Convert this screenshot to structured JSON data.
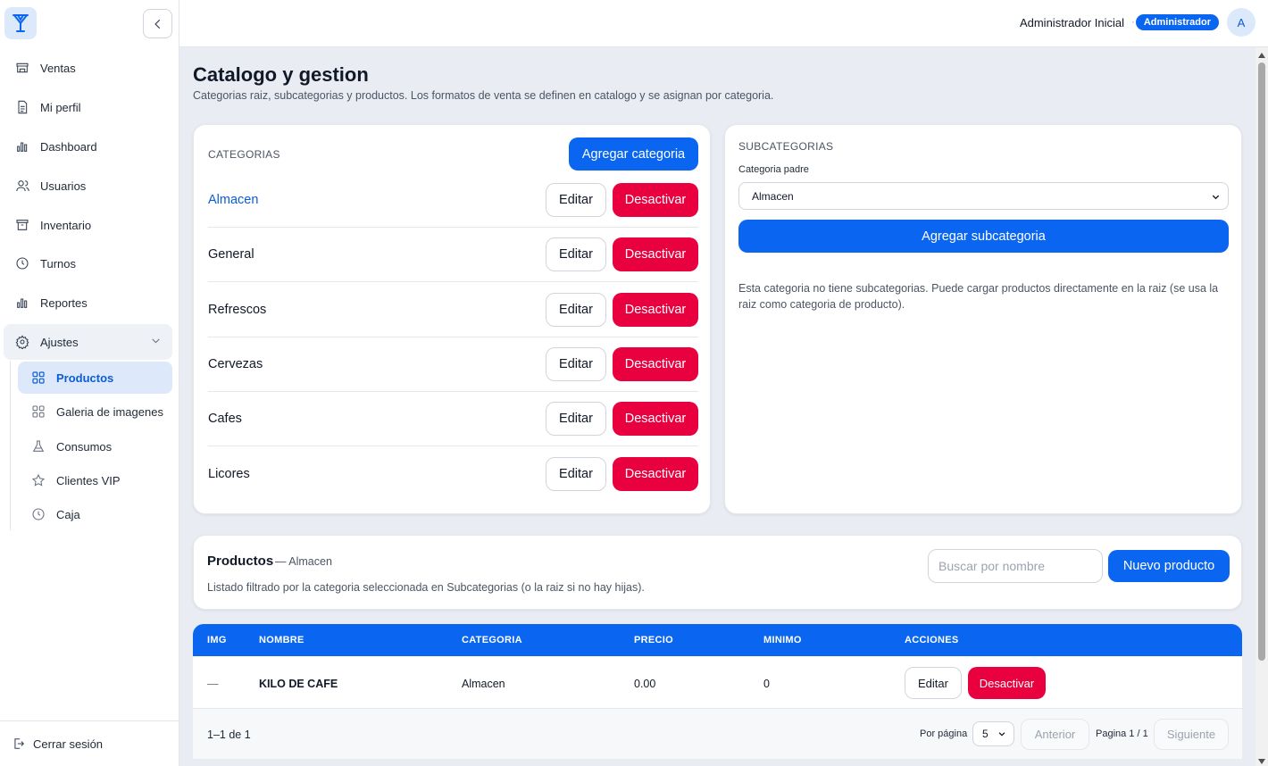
{
  "sidebar": {
    "items": [
      {
        "label": "Ventas",
        "icon": "store-icon"
      },
      {
        "label": "Mi perfil",
        "icon": "document-icon"
      },
      {
        "label": "Dashboard",
        "icon": "bar-chart-icon"
      },
      {
        "label": "Usuarios",
        "icon": "users-icon"
      },
      {
        "label": "Inventario",
        "icon": "archive-icon"
      },
      {
        "label": "Turnos",
        "icon": "clock-icon"
      },
      {
        "label": "Reportes",
        "icon": "bar-chart-icon"
      },
      {
        "label": "Ajustes",
        "icon": "gear-icon"
      }
    ],
    "sub_items": [
      {
        "label": "Productos",
        "icon": "grid-icon"
      },
      {
        "label": "Galeria de imagenes",
        "icon": "grid-icon"
      },
      {
        "label": "Consumos",
        "icon": "flask-icon"
      },
      {
        "label": "Clientes VIP",
        "icon": "star-icon"
      },
      {
        "label": "Caja",
        "icon": "clock-icon"
      }
    ],
    "logout": "Cerrar sesión"
  },
  "topbar": {
    "user_name": "Administrador Inicial",
    "separator": "·",
    "role": "Administrador",
    "avatar": "A"
  },
  "page": {
    "title": "Catalogo y gestion",
    "subtitle": "Categorias raiz, subcategorias y productos. Los formatos de venta se definen en catalogo y se asignan por categoria."
  },
  "categories": {
    "label": "CATEGORIAS",
    "add_button": "Agregar categoria",
    "edit_label": "Editar",
    "deactivate_label": "Desactivar",
    "items": [
      "Almacen",
      "General",
      "Refrescos",
      "Cervezas",
      "Cafes",
      "Licores"
    ]
  },
  "subcategories": {
    "label": "SUBCATEGORIAS",
    "parent_label": "Categoria padre",
    "parent_value": "Almacen",
    "add_button": "Agregar subcategoria",
    "empty_message": "Esta categoria no tiene subcategorias. Puede cargar productos directamente en la raiz (se usa la raiz como categoria de producto)."
  },
  "products": {
    "title": "Productos",
    "filter": "— Almacen",
    "description": "Listado filtrado por la categoria seleccionada en Subcategorias (o la raiz si no hay hijas).",
    "search_placeholder": "Buscar por nombre",
    "new_button": "Nuevo producto",
    "columns": [
      "IMG",
      "NOMBRE",
      "CATEGORIA",
      "PRECIO",
      "MINIMO",
      "ACCIONES"
    ],
    "rows": [
      {
        "img": "—",
        "name": "KILO DE CAFE",
        "category": "Almacen",
        "price": "0.00",
        "min": "0"
      }
    ],
    "edit_label": "Editar",
    "deactivate_label": "Desactivar",
    "range": "1–1 de 1",
    "per_page_label": "Por página",
    "per_page_value": "5",
    "prev": "Anterior",
    "page_info": "Pagina 1 / 1",
    "next": "Siguiente"
  },
  "colors": {
    "primary": "#0a66f0",
    "danger": "#e8003f",
    "background": "#e9edf3"
  }
}
